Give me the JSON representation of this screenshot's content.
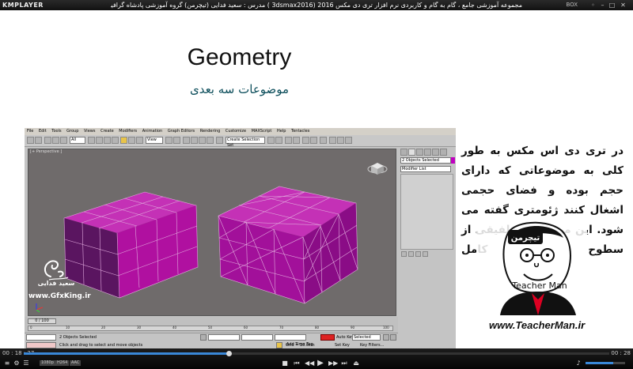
{
  "player": {
    "logo": "KMPLAYER",
    "title": "مجموعه آموزشی جامع ، گام به گام و کاربردی نرم افزار تری دی مکس 2016 (3dsmax2016 ) مدرس : سعید فدایی (تیچرمن) گروه آموزشی پادشاه گرافیست ها",
    "box_label": "BOX",
    "time_elapsed": "00 : 18 : 27",
    "time_total": "00 : 28",
    "progress_fraction": 0.35,
    "volume_fraction": 0.7,
    "tags": [
      "1080p",
      "H264",
      "AAC"
    ]
  },
  "slide": {
    "title": "Geometry",
    "subtitle": "موضوعات سه بعدی",
    "body_text": "در تری دی اس مکس به طور کلی به موضوعاتی که دارای حجم بوده و فضای حجمی اشغال کنند ژئومتری گفته می شود. این موضوعات تلفیقی از سطوح کامل",
    "watermark_name": "سعید فدایی",
    "watermark_site": "www.GfxKing.ir",
    "teacher_logo_text": "تیچرمن",
    "teacher_caption": "Teacher Man",
    "teacher_url": "www.TeacherMan",
    "teacher_url_suffix": ".ir"
  },
  "max_ui": {
    "menus": [
      "File",
      "Edit",
      "Tools",
      "Group",
      "Views",
      "Create",
      "Modifiers",
      "Animation",
      "Graph Editors",
      "Rendering",
      "Customize",
      "MAXScript",
      "Help",
      "Tentacles"
    ],
    "filter_dropdown": "All",
    "view_dropdown": "View",
    "selection_set": "Create Selection Set",
    "viewport_label": "[+ Perspective ]",
    "command_panel": {
      "selection_info": "2 Objects Selected",
      "modifier_list": "Modifier List"
    },
    "time_slider": "0 / 100",
    "ruler_ticks": [
      "0",
      "10",
      "20",
      "30",
      "40",
      "50",
      "60",
      "70",
      "80",
      "90",
      "100"
    ],
    "status": {
      "objects_selected": "2 Objects Selected",
      "prompt": "Click and drag to select and move objects",
      "grid": "Grid = 10.0cm",
      "add_time_tag": "Add Time Tag",
      "auto_key": "Auto Key",
      "selected": "Selected",
      "set_key": "Set Key",
      "key_filters": "Key Filters..."
    }
  },
  "colors": {
    "box_face": "#b812a8",
    "viewport_bg": "#6f6b6b",
    "subtitle": "#0e4f5c",
    "seek": "#3a88d8"
  }
}
